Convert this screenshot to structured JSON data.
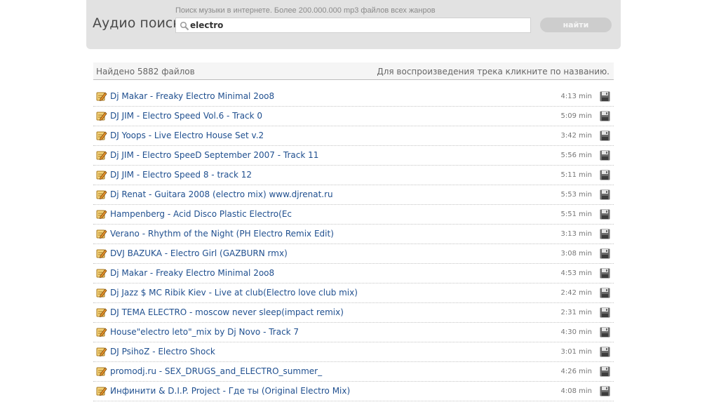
{
  "search": {
    "title": "Аудио поиск",
    "tagline": "Поиск музыки в интернете. Более 200.000.000 mp3 файлов всех жанров",
    "query": "electro",
    "button_label": "найти"
  },
  "results": {
    "count_text": "Найдено 5882 файлов",
    "hint_text": "Для воспроизведения трека кликните по названию."
  },
  "tracks": [
    {
      "title": "Dj Makar - Freaky Electro Minimal 2oo8",
      "duration": "4:13 min"
    },
    {
      "title": "DJ JIM - Electro Speed Vol.6 - Track 0",
      "duration": "5:09 min"
    },
    {
      "title": "DJ Yoops - Live Electro House Set v.2",
      "duration": "3:42 min"
    },
    {
      "title": "Dj JIM - Electro SpeeD September 2007 - Track 11",
      "duration": "5:56 min"
    },
    {
      "title": "DJ JIM - Electro Speed 8 - track 12",
      "duration": "5:11 min"
    },
    {
      "title": "Dj Renat - Guitara 2008 (electro mix) www.djrenat.ru",
      "duration": "5:53 min"
    },
    {
      "title": "Hampenberg - Acid Disco Plastic Electro(Ec",
      "duration": "5:51 min"
    },
    {
      "title": "Verano - Rhythm of the Night (PH Electro Remix Edit)",
      "duration": "3:13 min"
    },
    {
      "title": "DVJ BAZUKA - Electro Girl (GAZBURN rmx)",
      "duration": "3:08 min"
    },
    {
      "title": "Dj Makar - Freaky Electro Minimal 2oo8",
      "duration": "4:53 min"
    },
    {
      "title": "Dj Jazz $ MC Ribik Kiev - Live at club(Electro love club mix)",
      "duration": "2:42 min"
    },
    {
      "title": "DJ TEMA ELECTRO - moscow never sleep(impact remix)",
      "duration": "2:31 min"
    },
    {
      "title": "House\"electro leto\"_mix by Dj Novo - Track 7",
      "duration": "4:30 min"
    },
    {
      "title": "DJ PsihoZ - Electro Shock",
      "duration": "3:01 min"
    },
    {
      "title": "promodj.ru - SEX_DRUGS_and_ELECTRO_summer_",
      "duration": "4:26 min"
    },
    {
      "title": "Инфинити & D.I.P. Project - Где ты (Original Electro Mix)",
      "duration": "4:08 min"
    }
  ],
  "colors": {
    "panel_bg": "#e2e2e2",
    "link": "#1f4f8f",
    "button_bg": "#cdcdcd"
  },
  "icons": {
    "search": "magnifier-icon",
    "track": "pencil-note-icon",
    "download": "floppy-disk-icon"
  }
}
